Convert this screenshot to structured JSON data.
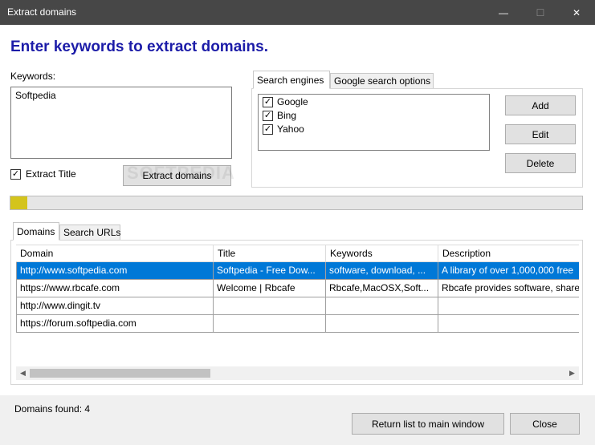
{
  "window": {
    "title": "Extract domains",
    "controls": {
      "minimize": "—",
      "maximize": "☐",
      "close": "✕"
    }
  },
  "heading": "Enter keywords to extract domains.",
  "keywords": {
    "label": "Keywords:",
    "value": "Softpedia"
  },
  "extract_title": {
    "label": "Extract Title",
    "checked": true
  },
  "extract_button": "Extract domains",
  "watermark": "SOFTPEDIA",
  "engine_tabs": [
    "Search engines",
    "Google search options"
  ],
  "engines": [
    {
      "name": "Google",
      "checked": true
    },
    {
      "name": "Bing",
      "checked": true
    },
    {
      "name": "Yahoo",
      "checked": true
    }
  ],
  "engine_buttons": {
    "add": "Add",
    "edit": "Edit",
    "delete": "Delete"
  },
  "progress": {
    "fraction": 0.03,
    "color": "#d4c41c"
  },
  "result_tabs": [
    "Domains",
    "Search URLs"
  ],
  "table": {
    "columns": [
      "Domain",
      "Title",
      "Keywords",
      "Description"
    ],
    "rows": [
      [
        "http://www.softpedia.com",
        "Softpedia - Free Dow...",
        "software, download, ...",
        "A library of over 1,000,000 free"
      ],
      [
        "https://www.rbcafe.com",
        "Welcome | Rbcafe",
        "Rbcafe,MacOSX,Soft...",
        "Rbcafe provides software, share"
      ],
      [
        "http://www.dingit.tv",
        "",
        "",
        ""
      ],
      [
        "https://forum.softpedia.com",
        "",
        "",
        ""
      ]
    ],
    "selected_row": 0
  },
  "status": "Domains found: 4",
  "footer_buttons": {
    "return": "Return list to main window",
    "close": "Close"
  },
  "colors": {
    "heading": "#1c1ca8",
    "selection": "#0078d7",
    "titlebar": "#474747"
  }
}
